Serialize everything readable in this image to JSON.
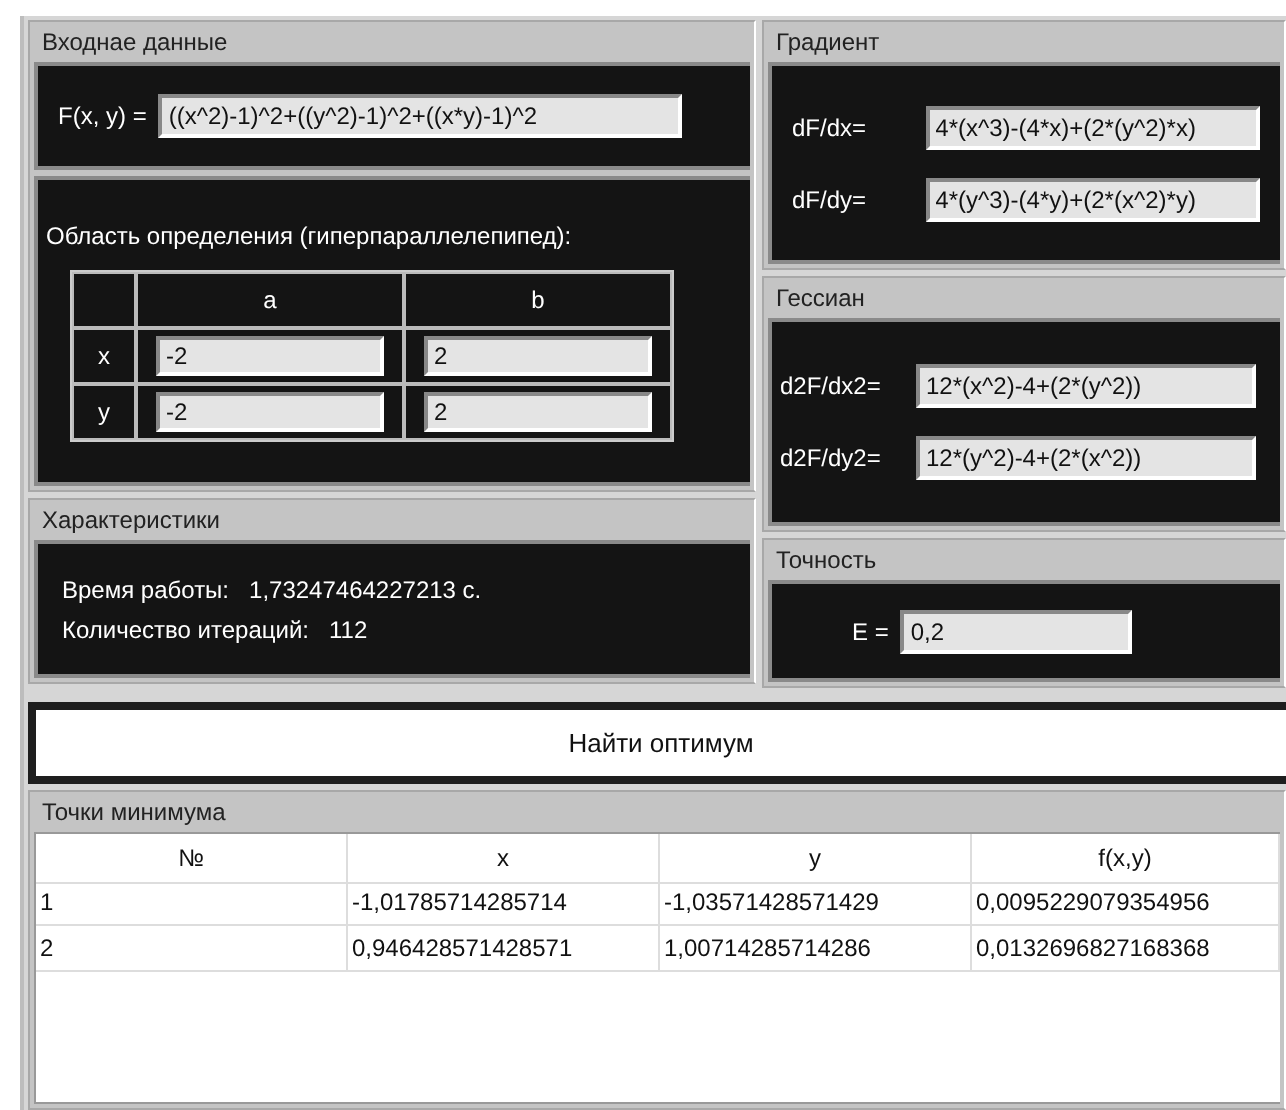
{
  "input": {
    "title": "Входнае данные",
    "function_label": "F(x, y) =",
    "function_value": "((x^2)-1)^2+((y^2)-1)^2+((x*y)-1)^2"
  },
  "domain": {
    "caption": "Область определения (гиперпараллелепипед):",
    "columns": [
      "a",
      "b"
    ],
    "rows": [
      {
        "label": "x",
        "values": [
          "-2",
          "2"
        ]
      },
      {
        "label": "y",
        "values": [
          "-2",
          "2"
        ]
      }
    ]
  },
  "characteristics": {
    "title": "Характеристики",
    "lines": [
      {
        "label": "Время работы:",
        "value": "1,73247464227213  с."
      },
      {
        "label": "Количество итераций:",
        "value": "112"
      }
    ]
  },
  "gradient": {
    "title": "Градиент",
    "fields": [
      {
        "label": "dF/dx=",
        "value": "4*(x^3)-(4*x)+(2*(y^2)*x)"
      },
      {
        "label": "dF/dy=",
        "value": "4*(y^3)-(4*y)+(2*(x^2)*y)"
      }
    ]
  },
  "hessian": {
    "title": "Гессиан",
    "fields": [
      {
        "label": "d2F/dx2=",
        "value": "12*(x^2)-4+(2*(y^2))"
      },
      {
        "label": "d2F/dy2=",
        "value": "12*(y^2)-4+(2*(x^2))"
      }
    ]
  },
  "accuracy": {
    "title": "Точность",
    "label": "E =",
    "value": "0,2"
  },
  "find_button": "Найти оптимум",
  "minimum_points": {
    "title": "Точки минимума",
    "columns": [
      "№",
      "x",
      "y",
      "f(x,y)"
    ],
    "rows": [
      [
        "1",
        "-1,01785714285714",
        "-1,03571428571429",
        "0,0095229079354956"
      ],
      [
        "2",
        "0,946428571428571",
        "1,00714285714286",
        "0,0132696827168368"
      ]
    ]
  }
}
